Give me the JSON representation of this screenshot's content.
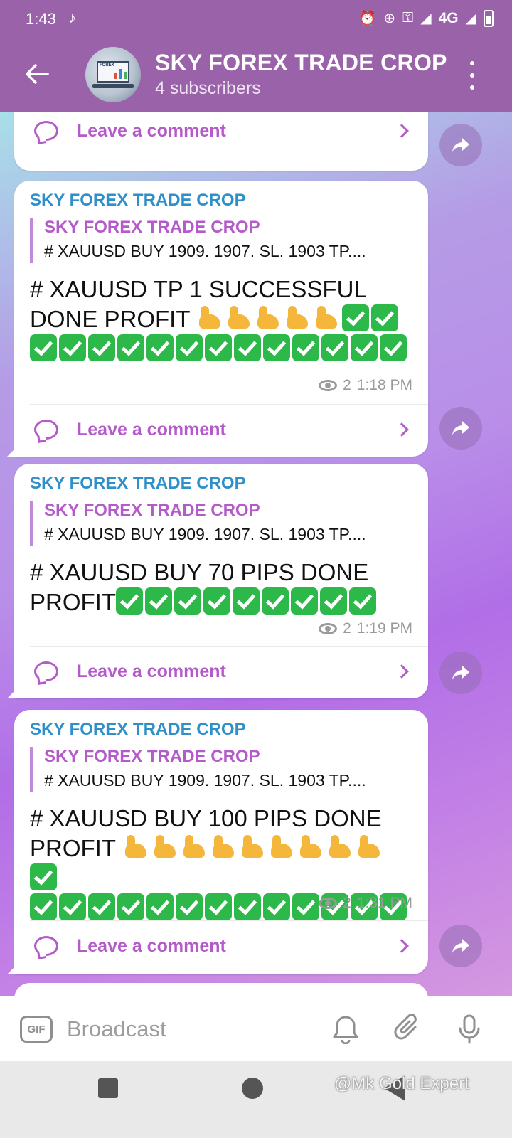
{
  "status_bar": {
    "time": "1:43",
    "network": "4G"
  },
  "header": {
    "title": "SKY FOREX TRADE CROP",
    "subtitle": "4 subscribers",
    "bg_color": "#9a62a8"
  },
  "comment_label": "Leave a comment",
  "messages": [
    {
      "sender": "SKY FOREX TRADE CROP",
      "reply_name": "SKY FOREX TRADE CROP",
      "reply_text": "# XAUUSD BUY 1909. 1907.   SL.  1903  TP....",
      "text_lines": [
        "# XAUUSD TP 1 SUCCESSFUL",
        "DONE PROFIT"
      ],
      "muscle_count": 5,
      "check_count": 15,
      "views": "2",
      "time": "1:18 PM"
    },
    {
      "sender": "SKY FOREX TRADE CROP",
      "reply_name": "SKY FOREX TRADE CROP",
      "reply_text": "# XAUUSD BUY 1909. 1907.   SL.  1903  TP....",
      "text_lines": [
        "# XAUUSD BUY 70 PIPS DONE",
        "PROFIT"
      ],
      "muscle_count": 0,
      "check_count": 9,
      "views": "2",
      "time": "1:19 PM"
    },
    {
      "sender": "SKY FOREX TRADE CROP",
      "reply_name": "SKY FOREX TRADE CROP",
      "reply_text": "# XAUUSD BUY 1909. 1907.   SL.  1903  TP....",
      "text_lines": [
        "# XAUUSD BUY 100 PIPS DONE",
        "PROFIT "
      ],
      "muscle_count": 9,
      "check_count": 14,
      "views": "2",
      "time": "1:31 PM"
    }
  ],
  "input": {
    "gif_label": "GIF",
    "placeholder": "Broadcast"
  },
  "watermark": "@Mk Gold Expert"
}
